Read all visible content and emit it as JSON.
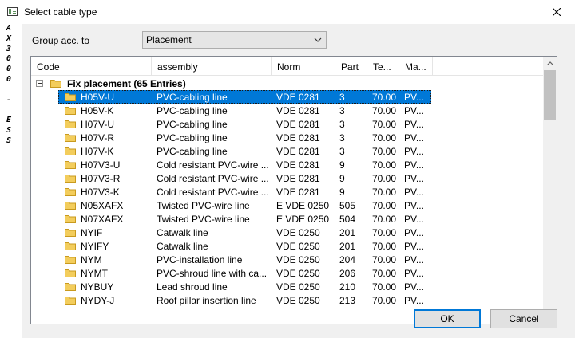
{
  "window": {
    "title": "Select cable type"
  },
  "sidebar": {
    "letters": [
      "A",
      "X",
      "3",
      "0",
      "0",
      "0",
      "",
      "-",
      "",
      "E",
      "S",
      "S"
    ]
  },
  "group": {
    "label": "Group acc. to",
    "selected": "Placement"
  },
  "tree": {
    "columns": [
      "Code",
      "assembly",
      "Norm",
      "Part",
      "Te...",
      "Ma..."
    ],
    "group_label": "Fix placement (65 Entries)",
    "rows": [
      {
        "code": "H05V-U",
        "assembly": "PVC-cabling line",
        "norm": "VDE 0281",
        "part": "3",
        "temp": "70.00",
        "ma": "PV..."
      },
      {
        "code": "H05V-K",
        "assembly": "PVC-cabling line",
        "norm": "VDE 0281",
        "part": "3",
        "temp": "70.00",
        "ma": "PV..."
      },
      {
        "code": "H07V-U",
        "assembly": "PVC-cabling line",
        "norm": "VDE 0281",
        "part": "3",
        "temp": "70.00",
        "ma": "PV..."
      },
      {
        "code": "H07V-R",
        "assembly": "PVC-cabling line",
        "norm": "VDE 0281",
        "part": "3",
        "temp": "70.00",
        "ma": "PV..."
      },
      {
        "code": "H07V-K",
        "assembly": "PVC-cabling line",
        "norm": "VDE 0281",
        "part": "3",
        "temp": "70.00",
        "ma": "PV..."
      },
      {
        "code": "H07V3-U",
        "assembly": "Cold resistant PVC-wire ...",
        "norm": "VDE 0281",
        "part": "9",
        "temp": "70.00",
        "ma": "PV..."
      },
      {
        "code": "H07V3-R",
        "assembly": "Cold resistant PVC-wire ...",
        "norm": "VDE 0281",
        "part": "9",
        "temp": "70.00",
        "ma": "PV..."
      },
      {
        "code": "H07V3-K",
        "assembly": "Cold resistant PVC-wire ...",
        "norm": "VDE 0281",
        "part": "9",
        "temp": "70.00",
        "ma": "PV..."
      },
      {
        "code": "N05XAFX",
        "assembly": "Twisted PVC-wire line",
        "norm": "E VDE 0250",
        "part": "505",
        "temp": "70.00",
        "ma": "PV..."
      },
      {
        "code": "N07XAFX",
        "assembly": "Twisted PVC-wire line",
        "norm": "E VDE 0250",
        "part": "504",
        "temp": "70.00",
        "ma": "PV..."
      },
      {
        "code": "NYIF",
        "assembly": "Catwalk line",
        "norm": "VDE 0250",
        "part": "201",
        "temp": "70.00",
        "ma": "PV..."
      },
      {
        "code": "NYIFY",
        "assembly": "Catwalk line",
        "norm": "VDE 0250",
        "part": "201",
        "temp": "70.00",
        "ma": "PV..."
      },
      {
        "code": "NYM",
        "assembly": "PVC-installation line",
        "norm": "VDE 0250",
        "part": "204",
        "temp": "70.00",
        "ma": "PV..."
      },
      {
        "code": "NYMT",
        "assembly": "PVC-shroud line with ca...",
        "norm": "VDE 0250",
        "part": "206",
        "temp": "70.00",
        "ma": "PV..."
      },
      {
        "code": "NYBUY",
        "assembly": "Lead shroud line",
        "norm": "VDE 0250",
        "part": "210",
        "temp": "70.00",
        "ma": "PV..."
      },
      {
        "code": "NYDY-J",
        "assembly": "Roof pillar insertion line",
        "norm": "VDE 0250",
        "part": "213",
        "temp": "70.00",
        "ma": "PV..."
      }
    ],
    "selected_index": 0
  },
  "buttons": {
    "ok": "OK",
    "cancel": "Cancel"
  },
  "colors": {
    "selection": "#0078d7",
    "folder": "#e8b835",
    "dialog_bg": "#f0f0f0"
  }
}
